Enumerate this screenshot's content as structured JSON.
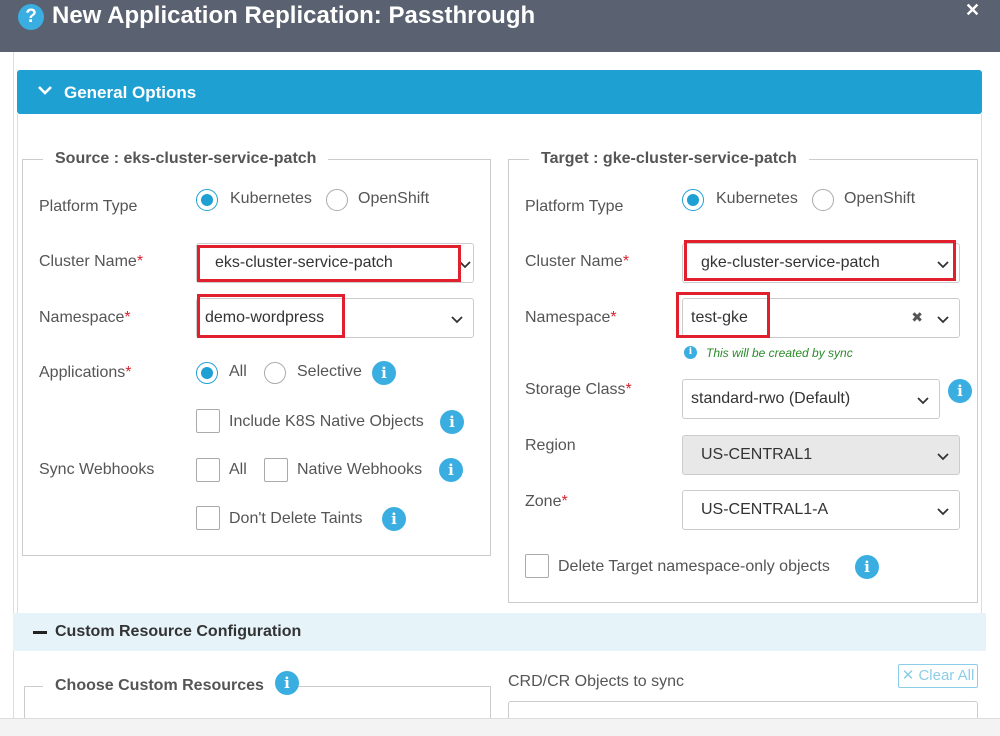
{
  "dialog": {
    "title": "New Application Replication: Passthrough",
    "help_icon": "question-circle-icon",
    "close_icon": "close-icon"
  },
  "general_options": {
    "label": "General Options",
    "source": {
      "legend": "Source : eks-cluster-service-patch",
      "platform_type_label": "Platform Type",
      "platform_options": [
        "Kubernetes",
        "OpenShift"
      ],
      "platform_selected": "Kubernetes",
      "cluster_name_label": "Cluster Name",
      "cluster_name_value": "eks-cluster-service-patch",
      "namespace_label": "Namespace",
      "namespace_value": "demo-wordpress",
      "applications_label": "Applications",
      "applications_options": [
        "All",
        "Selective"
      ],
      "applications_selected": "All",
      "include_k8s_label": "Include K8S Native Objects",
      "sync_webhooks_label": "Sync Webhooks",
      "sync_webhooks_all": "All",
      "sync_webhooks_native": "Native Webhooks",
      "dont_delete_taints": "Don't Delete Taints"
    },
    "target": {
      "legend": "Target : gke-cluster-service-patch",
      "platform_type_label": "Platform Type",
      "platform_options": [
        "Kubernetes",
        "OpenShift"
      ],
      "platform_selected": "Kubernetes",
      "cluster_name_label": "Cluster Name",
      "cluster_name_value": "gke-cluster-service-patch",
      "namespace_label": "Namespace",
      "namespace_value": "test-gke",
      "namespace_hint": "This will be created by sync",
      "storage_class_label": "Storage Class",
      "storage_class_value": "standard-rwo (Default)",
      "region_label": "Region",
      "region_value": "US-CENTRAL1",
      "zone_label": "Zone",
      "zone_value": "US-CENTRAL1-A",
      "delete_target_label": "Delete Target namespace-only objects"
    }
  },
  "custom_resource": {
    "label": "Custom Resource Configuration",
    "choose_label": "Choose Custom Resources",
    "crd_label": "CRD/CR Objects to sync",
    "clear_all": "Clear All"
  },
  "colors": {
    "titlebar": "#5a6170",
    "accent": "#1fa0d3",
    "highlight": "#e0202c",
    "required": "#d9232e"
  }
}
